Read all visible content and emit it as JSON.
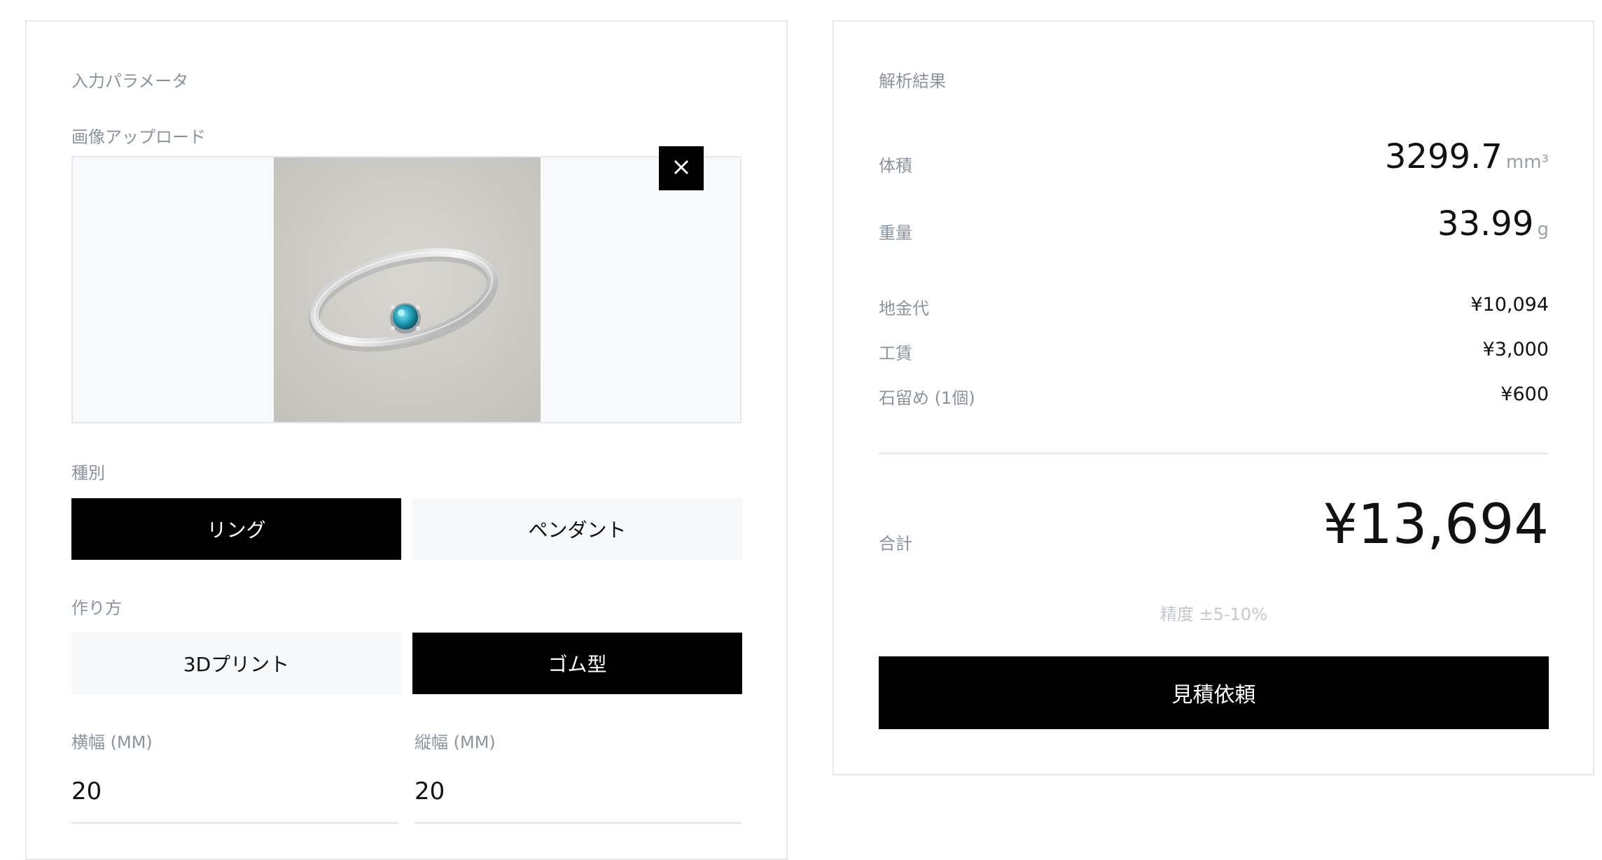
{
  "input_panel": {
    "title": "入力パラメータ",
    "upload": {
      "label": "画像アップロード"
    },
    "type": {
      "label": "種別",
      "options": [
        "リング",
        "ペンダント"
      ],
      "selected": "リング"
    },
    "method": {
      "label": "作り方",
      "options": [
        "3Dプリント",
        "ゴム型"
      ],
      "selected": "ゴム型"
    },
    "width": {
      "label": "横幅 (MM)",
      "value": "20"
    },
    "height": {
      "label": "縦幅 (MM)",
      "value": "20"
    }
  },
  "result_panel": {
    "title": "解析結果",
    "volume": {
      "label": "体積",
      "value": "3299.7",
      "unit": "mm³"
    },
    "weight": {
      "label": "重量",
      "value": "33.99",
      "unit": "g"
    },
    "costs": [
      {
        "label": "地金代",
        "value": "¥10,094"
      },
      {
        "label": "工賃",
        "value": "¥3,000"
      },
      {
        "label": "石留め (1個)",
        "value": "¥600"
      }
    ],
    "total": {
      "label": "合計",
      "value": "¥13,694"
    },
    "accuracy_note": "精度 ±5-10%",
    "quote_button": "見積依頼"
  },
  "colors": {
    "accent": "#000000",
    "muted_label": "#8b93a0",
    "option_bg": "#f7f8fa",
    "border": "#e6e8ec"
  }
}
